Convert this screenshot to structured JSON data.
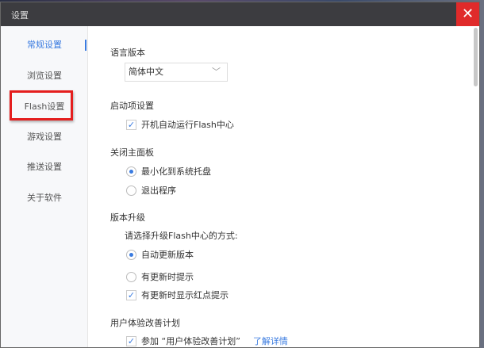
{
  "window": {
    "title": "设置",
    "close_label": "✕"
  },
  "sidebar": {
    "items": [
      {
        "label": "常规设置"
      },
      {
        "label": "浏览设置"
      },
      {
        "label": "Flash设置"
      },
      {
        "label": "游戏设置"
      },
      {
        "label": "推送设置"
      },
      {
        "label": "关于软件"
      }
    ]
  },
  "language": {
    "heading": "语言版本",
    "value": "简体中文",
    "chevron": "﹀"
  },
  "startup": {
    "heading": "启动项设置",
    "autostart": {
      "label": "开机自动运行Flash中心",
      "checked": true
    }
  },
  "close_panel": {
    "heading": "关闭主面板",
    "options": [
      {
        "label": "最小化到系统托盘",
        "selected": true
      },
      {
        "label": "退出程序",
        "selected": false
      }
    ]
  },
  "upgrade": {
    "heading": "版本升级",
    "prompt": "请选择升级Flash中心的方式:",
    "options": [
      {
        "label": "自动更新版本",
        "selected": true
      },
      {
        "label": "有更新时提示",
        "selected": false
      }
    ],
    "red_dot": {
      "label": "有更新时显示红点提示",
      "checked": true
    }
  },
  "ux": {
    "heading": "用户体验改善计划",
    "join": {
      "label": "参加 “用户体验改善计划”",
      "checked": true
    },
    "link": "了解详情"
  },
  "check_glyph": "✓"
}
